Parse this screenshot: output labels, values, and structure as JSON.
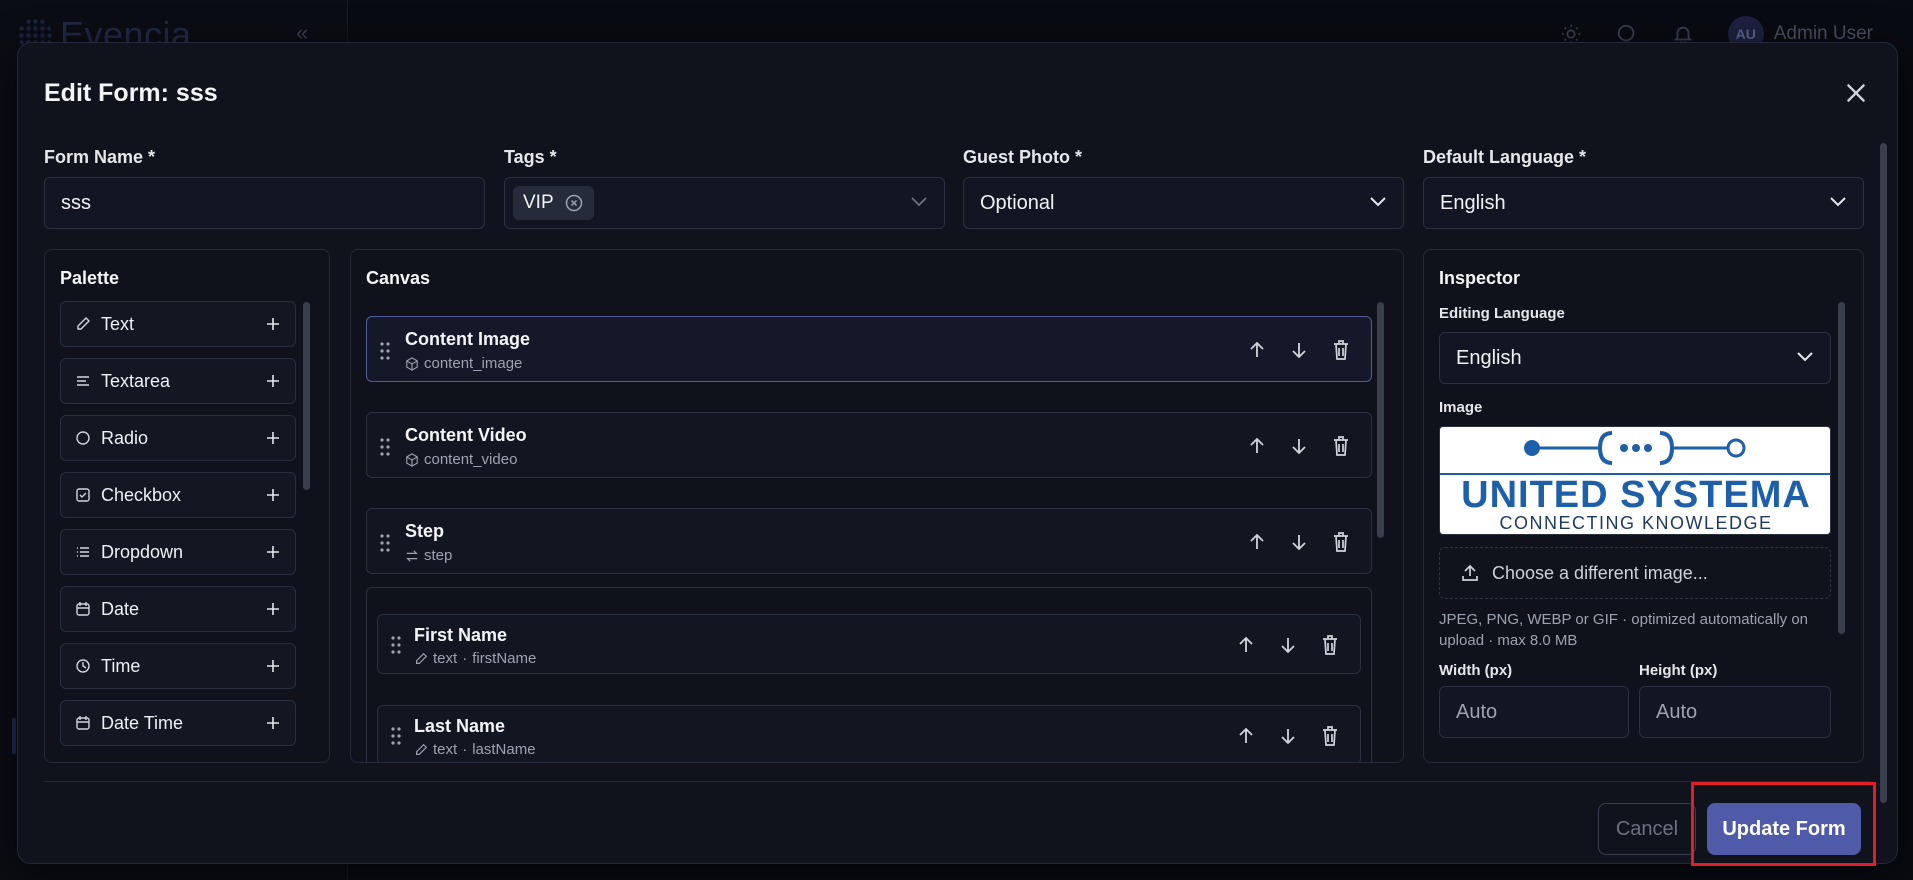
{
  "background": {
    "logo_text": "Evencia",
    "user_initials": "AU",
    "user_name": "Admin User"
  },
  "modal": {
    "title": "Edit Form: sss"
  },
  "fields": {
    "form_name_label": "Form Name *",
    "form_name_value": "sss",
    "tags_label": "Tags *",
    "tags": [
      "VIP"
    ],
    "guest_photo_label": "Guest Photo *",
    "guest_photo_value": "Optional",
    "default_language_label": "Default Language *",
    "default_language_value": "English"
  },
  "palette": {
    "title": "Palette",
    "items": [
      {
        "label": "Text",
        "icon": "pencil-icon"
      },
      {
        "label": "Textarea",
        "icon": "lines-icon"
      },
      {
        "label": "Radio",
        "icon": "circle-icon"
      },
      {
        "label": "Checkbox",
        "icon": "checkbox-icon"
      },
      {
        "label": "Dropdown",
        "icon": "list-icon"
      },
      {
        "label": "Date",
        "icon": "calendar-icon"
      },
      {
        "label": "Time",
        "icon": "clock-icon"
      },
      {
        "label": "Date Time",
        "icon": "calendar-icon"
      }
    ]
  },
  "canvas": {
    "title": "Canvas",
    "items": [
      {
        "name": "Content Image",
        "sub": "content_image"
      },
      {
        "name": "Content Video",
        "sub": "content_video"
      },
      {
        "name": "Step",
        "sub": "step"
      }
    ],
    "group_items": [
      {
        "name": "First Name",
        "type": "text",
        "key": "firstName"
      },
      {
        "name": "Last Name",
        "type": "text",
        "key": "lastName"
      }
    ]
  },
  "inspector": {
    "title": "Inspector",
    "editing_language_label": "Editing Language",
    "editing_language_value": "English",
    "image_label": "Image",
    "logo_title": "UNITED SYSTEMA",
    "logo_tagline": "CONNECTING KNOWLEDGE",
    "choose_label": "Choose a different image...",
    "help": "JPEG, PNG, WEBP or GIF · optimized automatically on upload · max 8.0 MB",
    "width_label": "Width (px)",
    "width_placeholder": "Auto",
    "height_label": "Height (px)",
    "height_placeholder": "Auto"
  },
  "footer": {
    "cancel_label": "Cancel",
    "update_label": "Update Form"
  },
  "colors": {
    "accent": "#4f5aa8",
    "highlight": "#e11d2a"
  }
}
